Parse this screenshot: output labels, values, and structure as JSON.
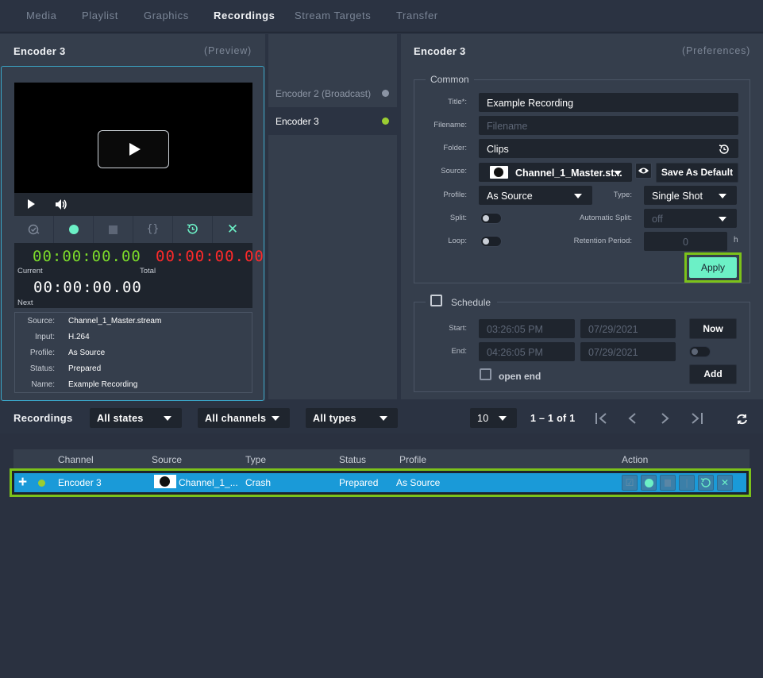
{
  "nav": {
    "tabs": [
      {
        "label": "Media"
      },
      {
        "label": "Playlist"
      },
      {
        "label": "Graphics"
      },
      {
        "label": "Recordings"
      },
      {
        "label": "Stream Targets"
      },
      {
        "label": "Transfer"
      }
    ],
    "active_tab": "Recordings"
  },
  "preview": {
    "title": "Encoder 3",
    "subtitle": "(Preview)",
    "timers": {
      "current": "00:00:00.00",
      "current_label": "Current",
      "total": "00:00:00.00",
      "total_label": "Total",
      "next": "00:00:00.00",
      "next_label": "Next"
    },
    "info": [
      {
        "key": "Source:",
        "value": "Channel_1_Master.stream"
      },
      {
        "key": "Input:",
        "value": "H.264"
      },
      {
        "key": "Profile:",
        "value": "As Source"
      },
      {
        "key": "Status:",
        "value": "Prepared"
      },
      {
        "key": "Name:",
        "value": "Example Recording"
      }
    ]
  },
  "encoders": [
    {
      "label": "Encoder 2 (Broadcast)",
      "color": "#8a93a3"
    },
    {
      "label": "Encoder 3",
      "color": "#9acd32"
    }
  ],
  "prefs": {
    "title": "Encoder 3",
    "subtitle": "(Preferences)",
    "common": {
      "legend": "Common",
      "title_label": "Title*:",
      "title_value": "Example Recording",
      "filename_label": "Filename:",
      "filename_placeholder": "Filename",
      "folder_label": "Folder:",
      "folder_value": "Clips",
      "source_label": "Source:",
      "source_value": "Channel_1_Master.st...",
      "save_default": "Save As Default",
      "profile_label": "Profile:",
      "profile_value": "As Source",
      "type_label": "Type:",
      "type_value": "Single Shot",
      "split_label": "Split:",
      "auto_split_label": "Automatic Split:",
      "auto_split_value": "off",
      "loop_label": "Loop:",
      "retention_label": "Retention Period:",
      "retention_value": "0",
      "retention_unit": "h",
      "apply": "Apply"
    },
    "schedule": {
      "legend": "Schedule",
      "start_label": "Start:",
      "start_time": "03:26:05 PM",
      "start_date": "07/29/2021",
      "end_label": "End:",
      "end_time": "04:26:05 PM",
      "end_date": "07/29/2021",
      "now": "Now",
      "add": "Add",
      "open_end": "open end"
    }
  },
  "recordings": {
    "title": "Recordings",
    "filters": {
      "states": "All states",
      "channels": "All channels",
      "types": "All types"
    },
    "page_size": "10",
    "pagination": "1 – 1 of 1",
    "columns": {
      "channel": "Channel",
      "source": "Source",
      "type": "Type",
      "status": "Status",
      "profile": "Profile",
      "action": "Action"
    },
    "rows": [
      {
        "channel": "Encoder 3",
        "source": "Channel_1_...",
        "type": "Crash",
        "status": "Prepared",
        "profile": "As Source"
      }
    ]
  },
  "colors": {
    "accent": "#6cf0c6",
    "green_timer": "#7cdc2a",
    "red_timer": "#ff2a2a",
    "highlight": "#7cc21a",
    "row_selected": "#1a9ad8"
  }
}
